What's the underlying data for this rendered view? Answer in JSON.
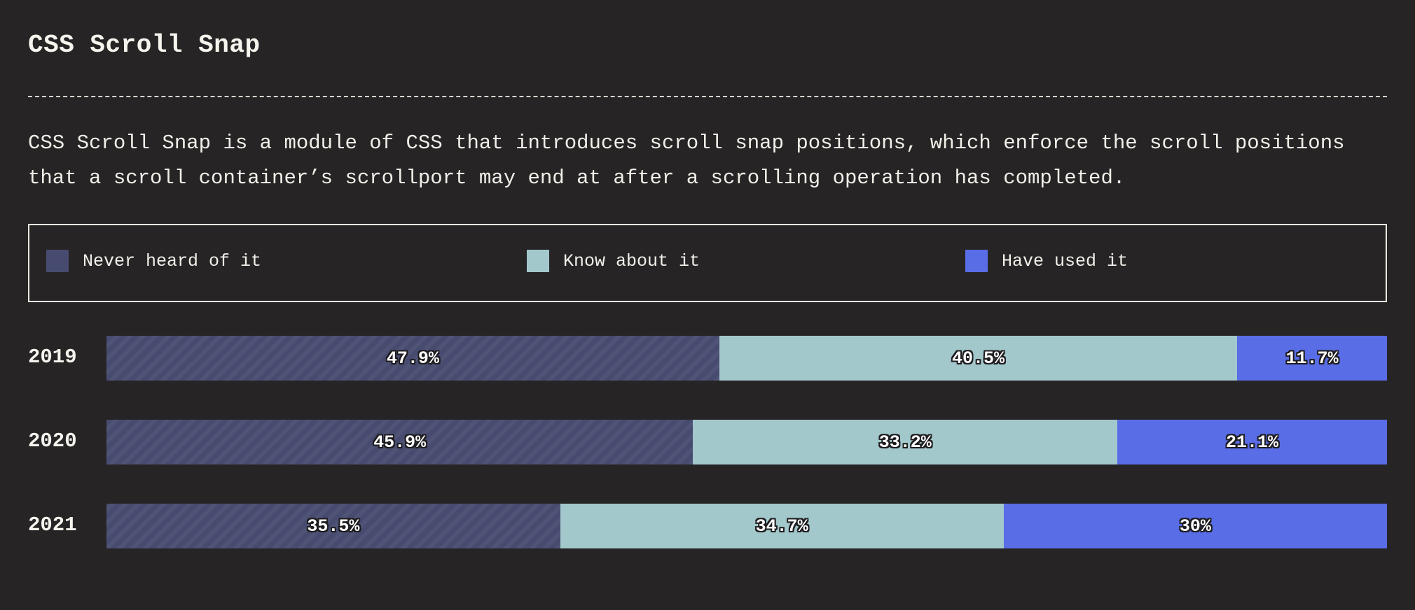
{
  "header": {
    "title": "CSS Scroll Snap",
    "description": "CSS Scroll Snap is a module of CSS that introduces scroll snap positions, which enforce the scroll positions that a scroll container’s scrollport may end at after a scrolling operation has completed."
  },
  "legend": [
    {
      "label": "Never heard of it",
      "color": "#474b6f"
    },
    {
      "label": "Know about it",
      "color": "#a2c8cc"
    },
    {
      "label": "Have used it",
      "color": "#586de6"
    }
  ],
  "chart_data": {
    "type": "bar",
    "orientation": "horizontal",
    "stacked": true,
    "categories": [
      "2019",
      "2020",
      "2021"
    ],
    "series": [
      {
        "name": "Never heard of it",
        "color": "#474b6f",
        "values": [
          47.9,
          45.9,
          35.5
        ],
        "labels": [
          "47.9%",
          "45.9%",
          "35.5%"
        ]
      },
      {
        "name": "Know about it",
        "color": "#a2c8cc",
        "values": [
          40.5,
          33.2,
          34.7
        ],
        "labels": [
          "40.5%",
          "33.2%",
          "34.7%"
        ]
      },
      {
        "name": "Have used it",
        "color": "#586de6",
        "values": [
          11.7,
          21.1,
          30
        ],
        "labels": [
          "11.7%",
          "21.1%",
          "30%"
        ]
      }
    ],
    "xlim": [
      0,
      100
    ],
    "grid": false,
    "legend_position": "top"
  }
}
